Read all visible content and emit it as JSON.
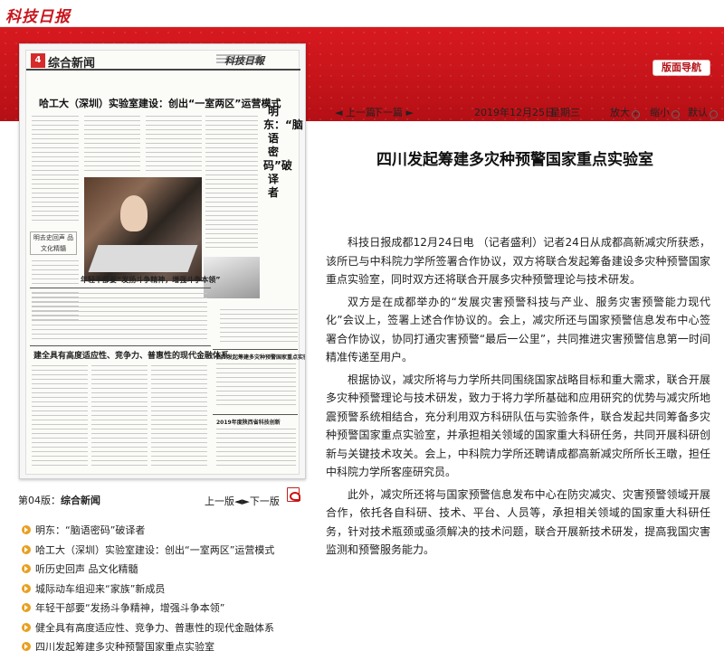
{
  "site": {
    "logo_text": "科技日报",
    "page_nav_label": "版面导航"
  },
  "paper": {
    "badge": "4",
    "section": "综合新闻",
    "masthead": "科技日報",
    "headline": "哈工大（深圳）实验室建设：创出“一室两区”运营模式",
    "vertical_title": "明东：“脑语密码”破译者",
    "sub1": "年轻干部要“发扬斗争精神，增强斗争本领”",
    "sub2": "建全具有高度适应性、竞争力、普惠性的现代金融体系",
    "sub3": "四川发起筹建多灾种预警国家重点实验室",
    "sub4": "2019年度陕西省科技创新",
    "side_box": "明去史回声 品文化精髓"
  },
  "toolbar": {
    "prev": "◄ 上一篇",
    "next": "下一篇 ►",
    "date": "2019年12月25日",
    "weekday": "星期三",
    "zoom_in": "放大",
    "zoom_out": "缩小",
    "default": "默认"
  },
  "article": {
    "title": "四川发起筹建多灾种预警国家重点实验室",
    "paragraphs": [
      "科技日报成都12月24日电 （记者盛利）记者24日从成都高新减灾所获悉，该所已与中科院力学所签署合作协议，双方将联合发起筹备建设多灾种预警国家重点实验室，同时双方还将联合开展多灾种预警理论与技术研发。",
      "双方是在成都举办的“发展灾害预警科技与产业、服务灾害预警能力现代化”会议上，签署上述合作协议的。会上，减灾所还与国家预警信息发布中心签署合作协议，协同打通灾害预警“最后一公里”，共同推进灾害预警信息第一时间精准传递至用户。",
      "根据协议，减灾所将与力学所共同围绕国家战略目标和重大需求，联合开展多灾种预警理论与技术研发，致力于将力学所基础和应用研究的优势与减灾所地震预警系统相结合，充分利用双方科研队伍与实验条件，联合发起共同筹备多灾种预警国家重点实验室，并承担相关领域的国家重大科研任务，共同开展科研创新与关键技术攻关。会上，中科院力学所还聘请成都高新减灾所所长王暾，担任中科院力学所客座研究员。",
      "此外，减灾所还将与国家预警信息发布中心在防灾减灾、灾害预警领域开展合作，依托各自科研、技术、平台、人员等，承担相关领域的国家重大科研任务，针对技术瓶颈或亟须解决的技术问题，联合开展新技术研发，提高我国灾害监测和预警服务能力。"
    ]
  },
  "page": {
    "label_prefix": "第04版：",
    "label_name": "综合新闻",
    "prev_page": "上一版",
    "next_page": "下一版"
  },
  "articles": [
    "明东：“脑语密码”破译者",
    "哈工大（深圳）实验室建设：创出“一室两区”运营模式",
    "听历史回声 品文化精髓",
    "城际动车组迎来“家族”新成员",
    "年轻干部要“发扬斗争精神，增强斗争本领”",
    "健全具有高度适应性、竞争力、普惠性的现代金融体系",
    "四川发起筹建多灾种预警国家重点实验室"
  ]
}
